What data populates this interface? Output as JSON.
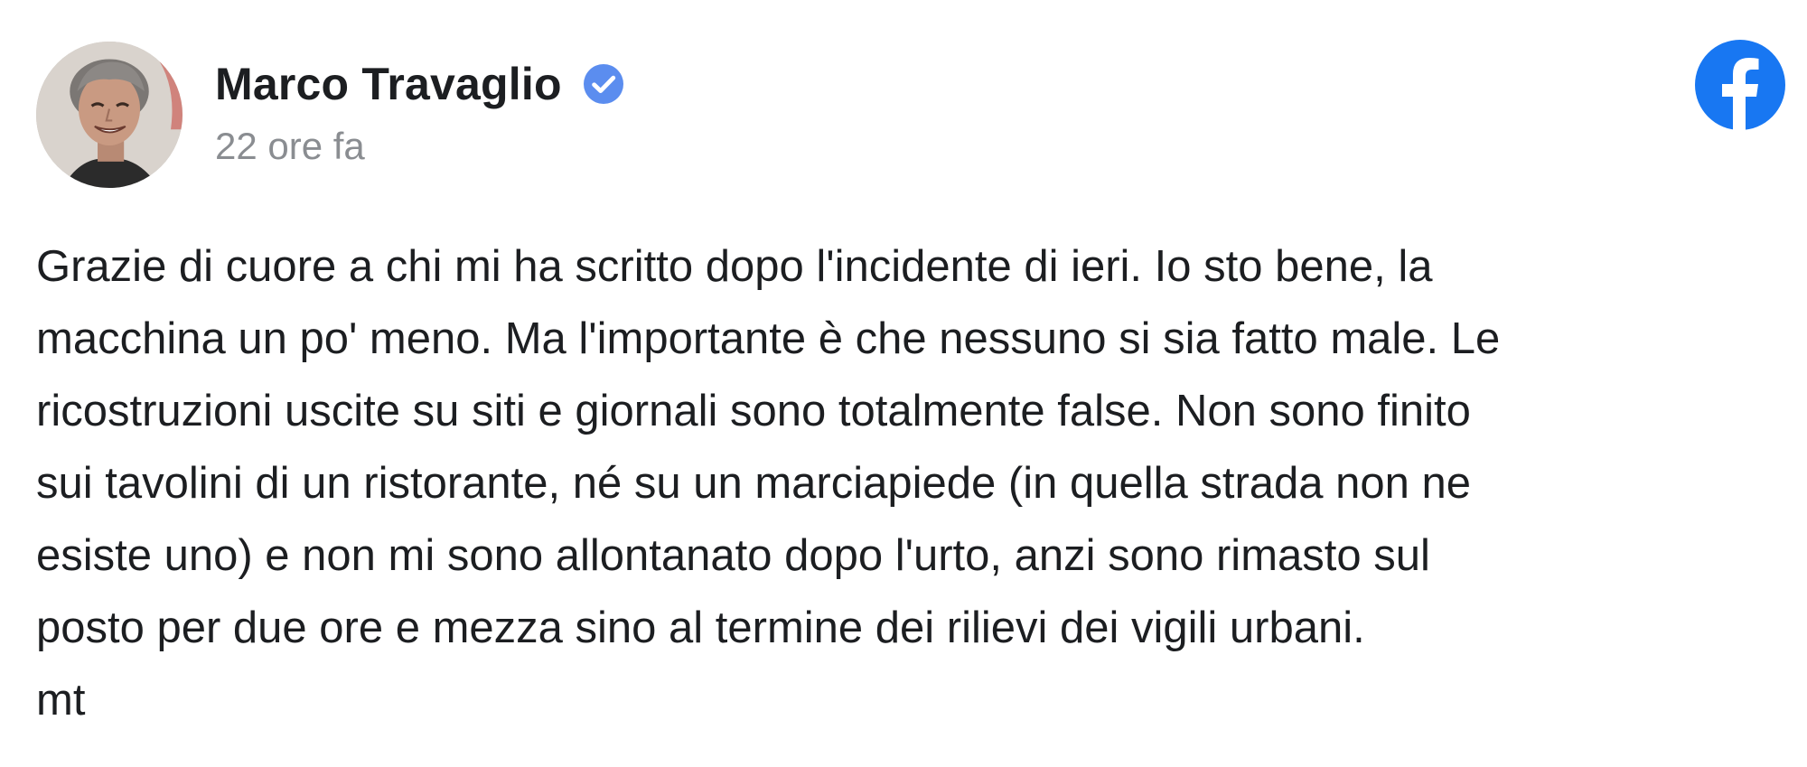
{
  "post": {
    "author": {
      "name": "Marco Travaglio",
      "verified": true,
      "avatar_icon": "profile-photo"
    },
    "timestamp": "22 ore fa",
    "platform_icon": "facebook-logo-icon",
    "text_lines": [
      "Grazie di cuore a chi mi ha scritto dopo l'incidente di ieri. Io sto bene, la",
      "macchina un po' meno. Ma l'importante è che nessuno si sia fatto male. Le",
      "ricostruzioni uscite su siti e giornali sono totalmente false. Non sono finito",
      "sui tavolini di un ristorante, né su un marciapiede (in quella strada non ne",
      "esiste uno) e non mi sono allontanato dopo l'urto, anzi sono rimasto sul",
      "posto per due ore e mezza sino al termine dei rilievi dei vigili urbani.",
      "mt"
    ]
  },
  "colors": {
    "facebook_blue": "#1877f2",
    "verified_blue": "#5b8def",
    "timestamp_gray": "#8a8d91",
    "text": "#1c1e21"
  }
}
